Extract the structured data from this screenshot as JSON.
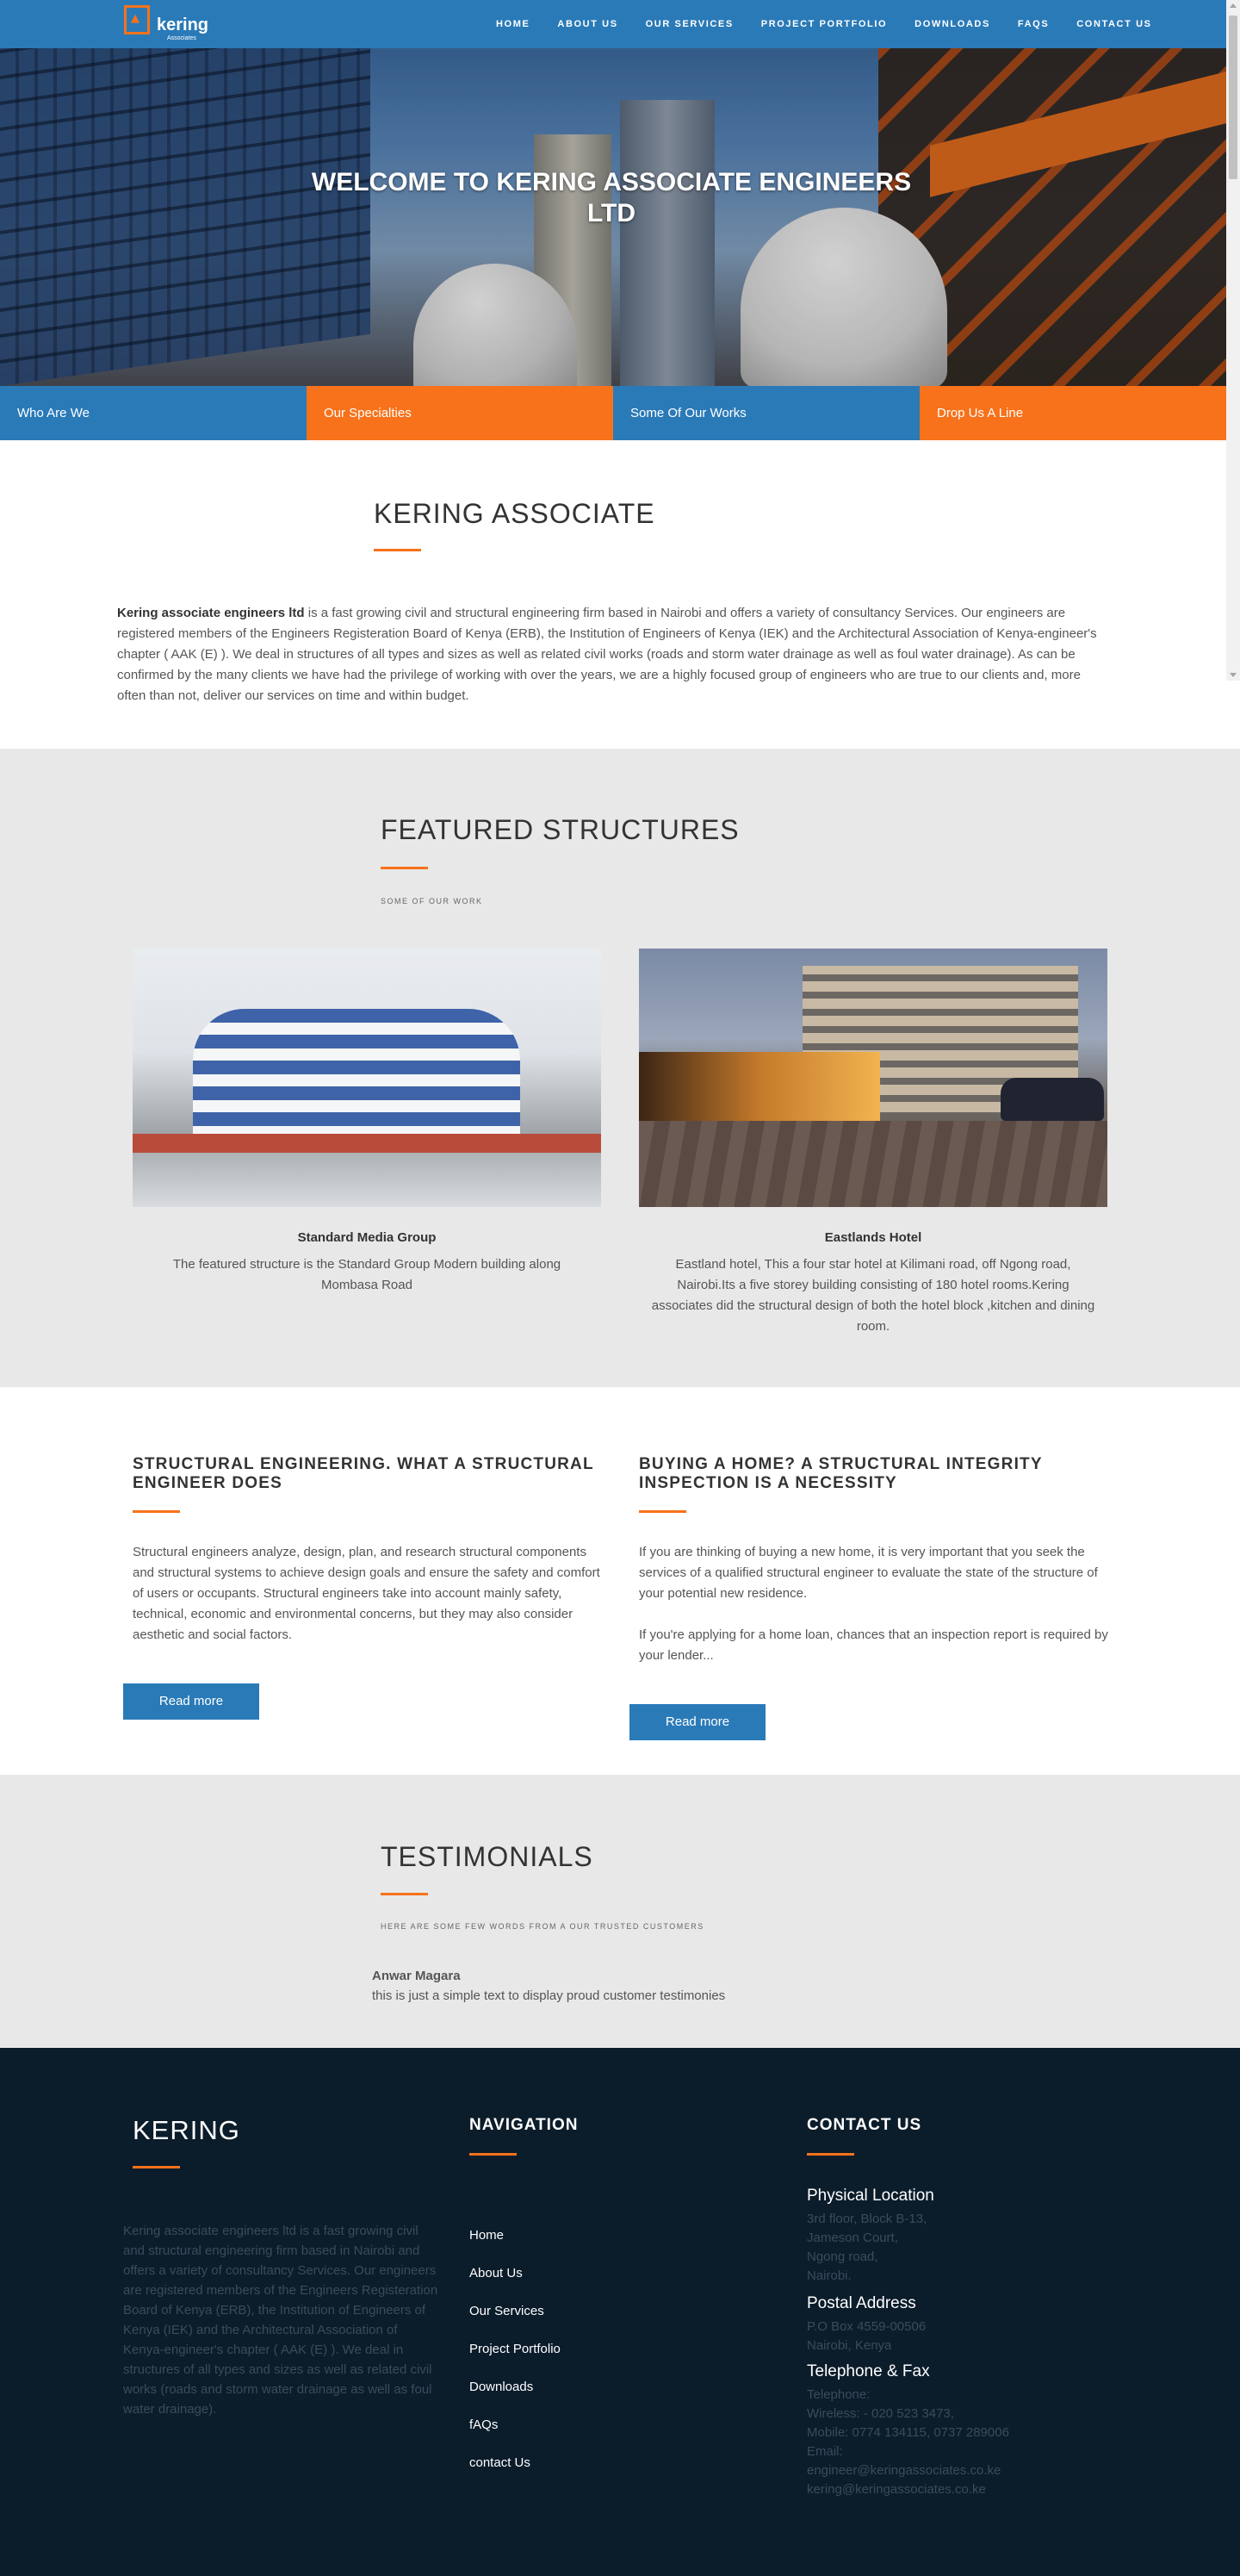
{
  "nav": {
    "logo_text": "kering",
    "logo_sub": "Associates",
    "items": [
      "HOME",
      "ABOUT US",
      "OUR SERVICES",
      "PROJECT PORTFOLIO",
      "DOWNLOADS",
      "FAQS",
      "CONTACT US"
    ]
  },
  "hero": {
    "title": "WELCOME TO KERING ASSOCIATE ENGINEERS LTD"
  },
  "tabs": [
    "Who Are We",
    "Our Specialties",
    "Some Of Our Works",
    "Drop Us A Line"
  ],
  "intro": {
    "title": "KERING ASSOCIATE",
    "lead": "Kering associate engineers ltd",
    "body": " is a fast growing civil and structural engineering firm based in Nairobi and offers a variety of consultancy Services. Our engineers are registered members of the Engineers Registeration Board of Kenya (ERB), the Institution of Engineers of Kenya (IEK) and the Architectural Association of Kenya-engineer's chapter ( AAK (E) ). We deal in structures of all types and sizes as well as related civil works (roads and storm water drainage as well as foul water drainage). As can be confirmed by the many clients we have had the privilege of working with over the years, we are a highly focused group of engineers who are true to our clients and, more often than not, deliver our services on time and within budget."
  },
  "featured": {
    "title": "FEATURED STRUCTURES",
    "subtitle": "SOME OF OUR WORK",
    "cards": [
      {
        "title": "Standard Media Group",
        "text": "The featured structure is the Standard Group Modern building along Mombasa Road"
      },
      {
        "title": "Eastlands Hotel",
        "text": "Eastland hotel, This a four star hotel at Kilimani road, off Ngong road, Nairobi.Its a five storey building consisting of 180 hotel rooms.Kering associates did the structural design of both the hotel block ,kitchen and dining room."
      }
    ]
  },
  "articles": [
    {
      "title": "STRUCTURAL ENGINEERING. WHAT A STRUCTURAL ENGINEER DOES",
      "paragraphs": [
        "Structural engineers analyze, design, plan, and research structural components and structural systems to achieve design goals and ensure the safety and comfort of users or occupants. Structural engineers take into account mainly safety, technical, economic and environmental concerns, but they may also consider aesthetic and social factors."
      ],
      "button": "Read more"
    },
    {
      "title": "BUYING A HOME? A STRUCTURAL INTEGRITY INSPECTION IS A NECESSITY",
      "paragraphs": [
        "If you are thinking of buying a new home, it is very important that you seek the services of a qualified structural engineer to evaluate the state of the structure of your potential new residence.",
        "If you're applying for a home loan, chances that an inspection report is required by your lender..."
      ],
      "button": "Read more"
    }
  ],
  "testimonials": {
    "title": "TESTIMONIALS",
    "subtitle": "HERE ARE SOME FEW WORDS FROM A OUR TRUSTED CUSTOMERS",
    "name": "Anwar Magara",
    "text": "this is just a simple text to display proud customer testimonies"
  },
  "footer": {
    "brand": "KERING",
    "about": "Kering associate engineers ltd is a fast growing civil and structural engineering firm based in Nairobi and offers a variety of consultancy Services. Our engineers are registered members of the Engineers Registeration Board of Kenya (ERB), the Institution of Engineers of Kenya (IEK) and the Architectural Association of Kenya-engineer's chapter ( AAK (E) ). We deal in structures of all types and sizes as well as related civil works (roads and storm water drainage as well as foul water drainage).",
    "nav_title": "NAVIGATION",
    "nav_items": [
      "Home",
      "About Us",
      "Our Services",
      "Project Portfolio",
      "Downloads",
      "fAQs",
      "contact Us"
    ],
    "contact_title": "CONTACT US",
    "physical_title": "Physical Location",
    "physical_lines": [
      "3rd floor, Block B-13,",
      "Jameson Court,",
      "Ngong road,",
      "Nairobi."
    ],
    "postal_title": "Postal Address",
    "postal_lines": [
      "P.O Box 4559-00506",
      "Nairobi, Kenya"
    ],
    "phone_title": "Telephone & Fax",
    "phone_lines": [
      "Telephone:",
      "Wireless: - 020 523 3473,",
      "Mobile: 0774 134115, 0737 289006",
      "Email:",
      "engineer@keringassociates.co.ke",
      "kering@keringassociates.co.ke"
    ]
  },
  "colors": {
    "primary_blue": "#2a7ab8",
    "accent_orange": "#f7721b",
    "footer_bg": "#0b1c2b",
    "section_gray": "#e8e8e8"
  }
}
